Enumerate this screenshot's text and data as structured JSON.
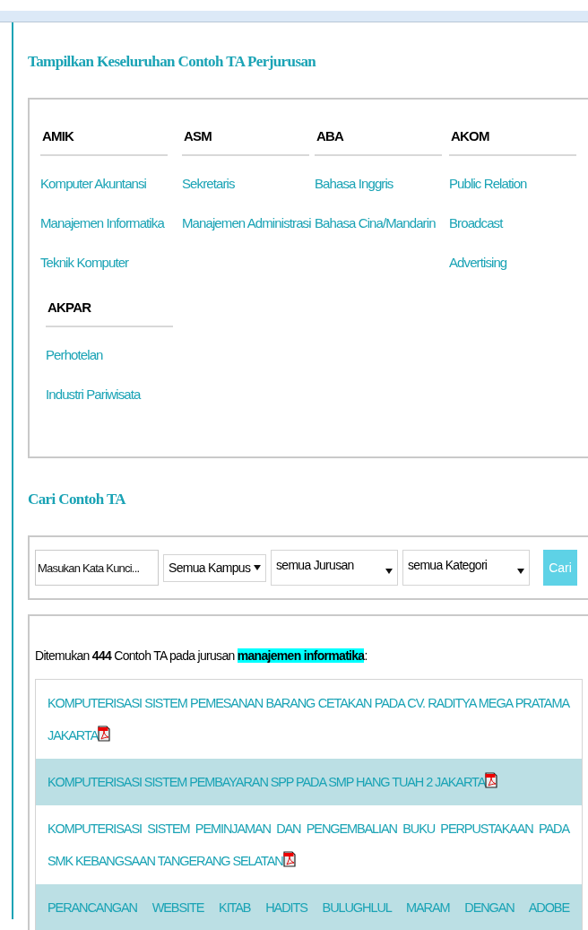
{
  "heading": "Tampilkan Keseluruhan Contoh TA Perjurusan",
  "groups": [
    {
      "title": "AMIK",
      "items": [
        "Komputer Akuntansi",
        "Manajemen Informatika",
        "Teknik Komputer"
      ]
    },
    {
      "title": "ASM",
      "items": [
        "Sekretaris",
        "Manajemen Administrasi"
      ]
    },
    {
      "title": "ABA",
      "items": [
        "Bahasa Inggris",
        "Bahasa Cina/Mandarin"
      ]
    },
    {
      "title": "AKOM",
      "items": [
        "Public Relation",
        "Broadcast",
        "Advertising"
      ]
    },
    {
      "title": "AKPAR",
      "items": [
        "Perhotelan",
        "Industri Pariwisata"
      ]
    }
  ],
  "search_heading": "Cari Contoh TA",
  "search": {
    "keyword": {
      "placeholder": "Masukan Kata Kunci..."
    },
    "selects": [
      "Semua Kampus",
      "semua Jurusan",
      "semua Kategori"
    ],
    "button": "Cari"
  },
  "result_summary": "Ditemukan **444** Contoh TA pada jurusan ",
  "result_major": "manajemen informatika",
  "result_colon": ":",
  "results": [
    {
      "title": "KOMPUTERISASI SISTEM PEMESANAN BARANG CETAKAN PADA CV. RADITYA MEGA PRATAMA JAKARTA",
      "pdf": true
    },
    {
      "title": "KOMPUTERISASI SISTEM PEMBAYARAN SPP PADA SMP HANG TUAH 2 JAKARTA",
      "pdf": true
    },
    {
      "title": "KOMPUTERISASI SISTEM PEMINJAMAN DAN PENGEMBALIAN BUKU PERPUSTAKAAN PADA SMK KEBANGSAAN TANGERANG SELATAN",
      "pdf": true
    },
    {
      "title": "PERANCANGAN WEBSITE KITAB HADITS BULUGHLUL MARAM DENGAN ADOBE",
      "pdf": false
    }
  ]
}
